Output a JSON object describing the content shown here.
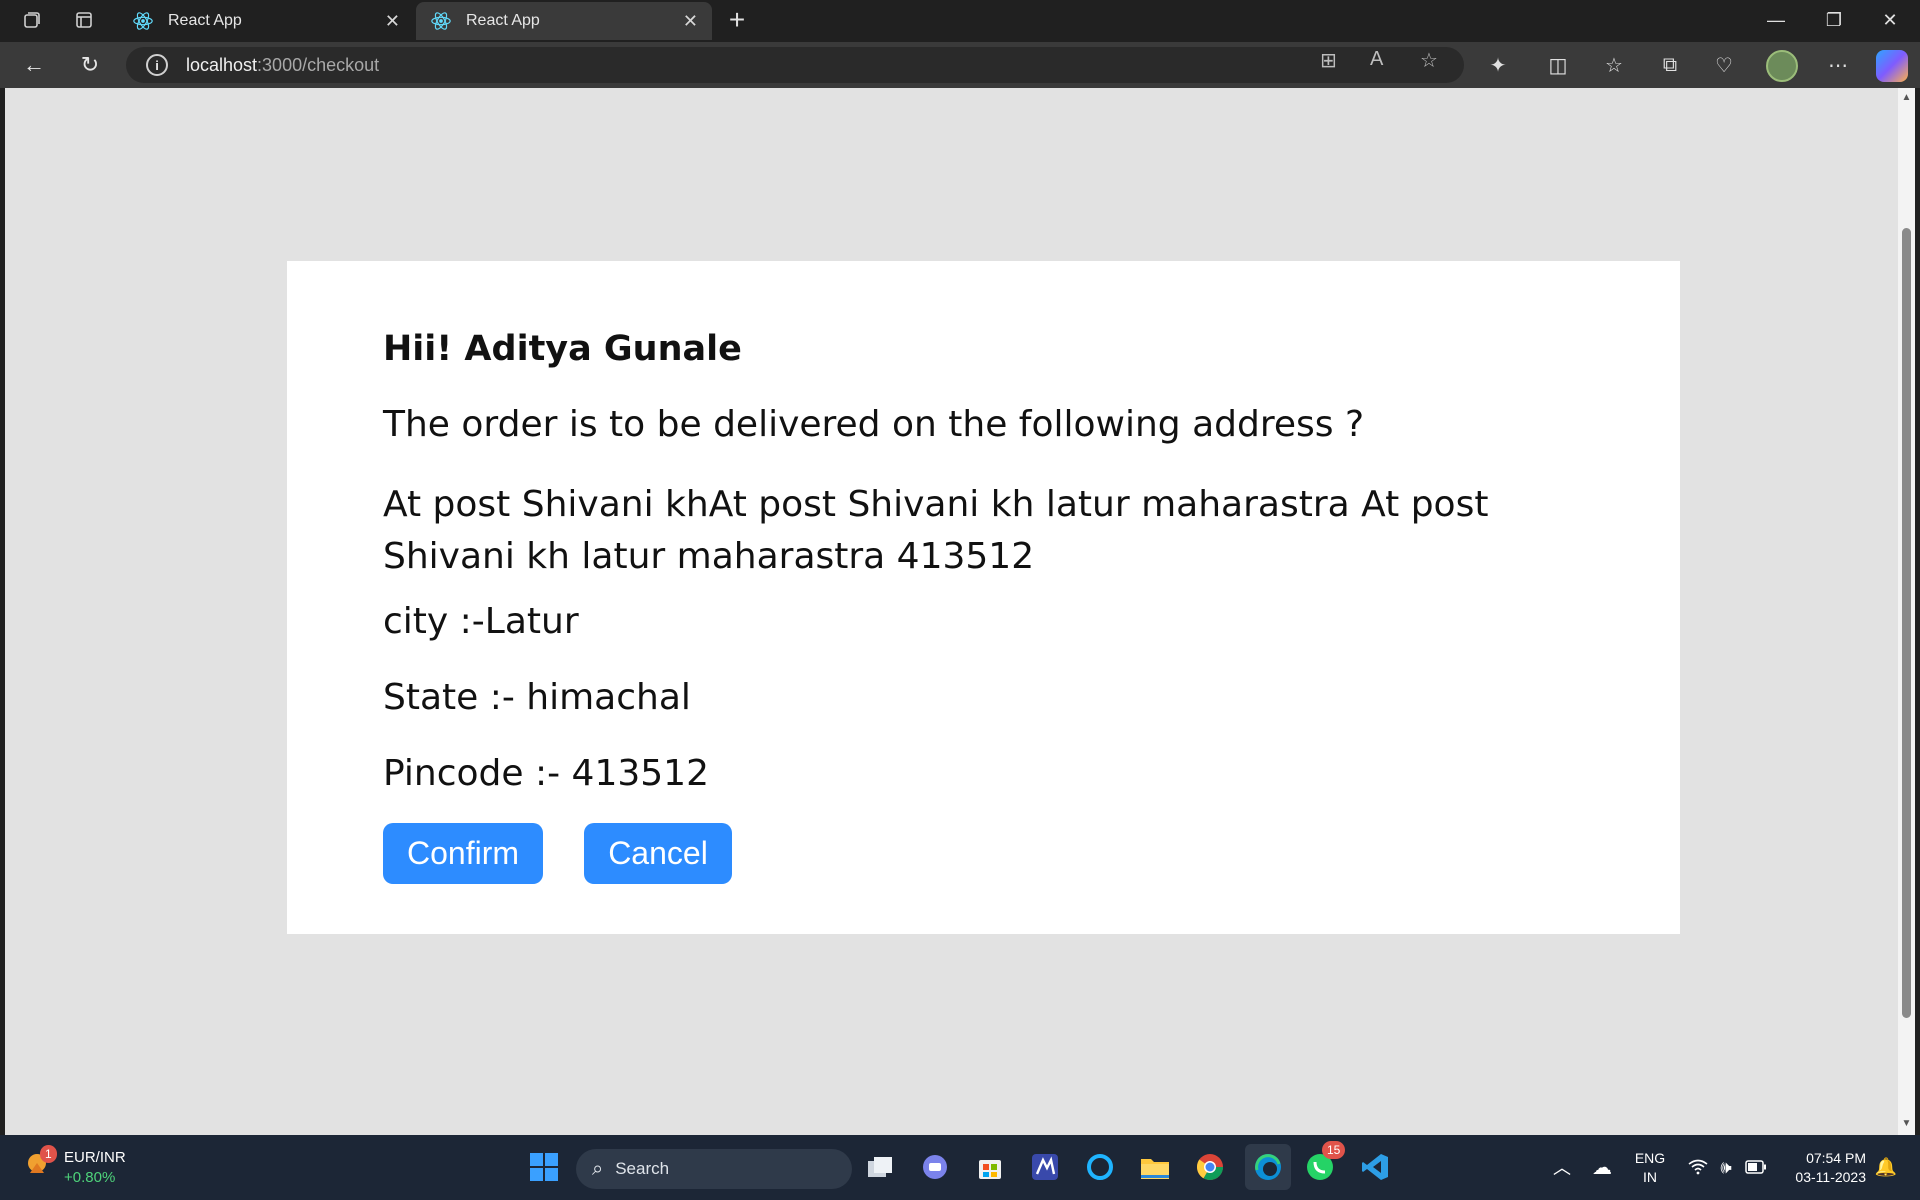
{
  "browser": {
    "tabs": [
      {
        "title": "React App",
        "active": false
      },
      {
        "title": "React App",
        "active": true
      }
    ],
    "url_host": "localhost",
    "url_path": ":3000/checkout"
  },
  "page": {
    "greeting": "Hii! Aditya Gunale",
    "question": "The order is to be delivered on the following address ?",
    "address": "At post Shivani khAt post Shivani kh latur maharastra At post Shivani kh latur maharastra 413512",
    "city": "city :-Latur",
    "state": "State :- himachal",
    "pincode": "Pincode :- 413512",
    "confirm_label": "Confirm",
    "cancel_label": "Cancel"
  },
  "taskbar": {
    "ticker_symbol": "EUR/INR",
    "ticker_change": "+0.80%",
    "ticker_badge": "1",
    "search_placeholder": "Search",
    "whatsapp_badge": "15",
    "lang_line1": "ENG",
    "lang_line2": "IN",
    "time": "07:54 PM",
    "date": "03-11-2023"
  },
  "colors": {
    "primary_button": "#2d8cff",
    "page_background": "#e2e2e2",
    "card_background": "#ffffff"
  }
}
